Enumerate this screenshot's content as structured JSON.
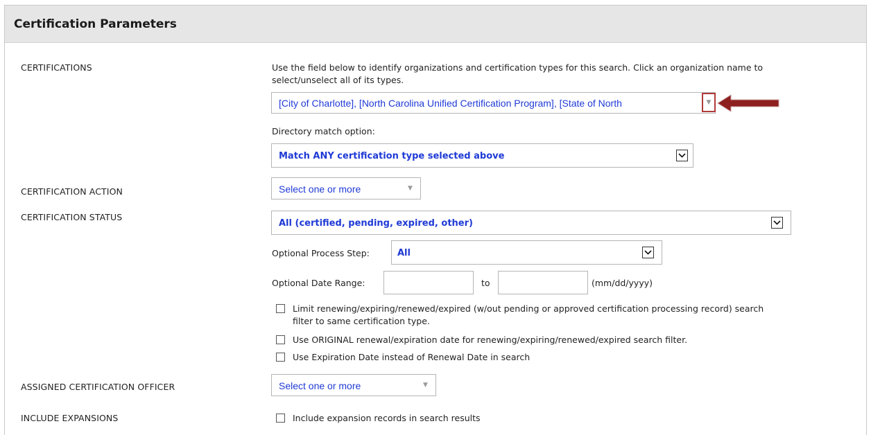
{
  "panel": {
    "title": "Certification Parameters"
  },
  "certifications": {
    "label": "CERTIFICATIONS",
    "help_line1": "Use the field below to identify organizations and certification types for this search. Click an organization name to",
    "help_line2": "select/unselect all of its types.",
    "selected_value": "[City of Charlotte], [North Carolina Unified Certification Program], [State of North",
    "dropdown_icon": "caret-down-icon",
    "match_label": "Directory match option:",
    "match_value": "Match ANY certification type selected above"
  },
  "certification_action": {
    "label": "CERTIFICATION ACTION",
    "placeholder": "Select one or more"
  },
  "certification_status": {
    "label": "CERTIFICATION STATUS",
    "value": "All (certified, pending, expired, other)",
    "process_step_label": "Optional Process Step:",
    "process_step_value": "All",
    "date_range_label": "Optional Date Range:",
    "date_from": "",
    "to_label": "to",
    "date_to": "",
    "date_format": "(mm/dd/yyyy)",
    "options": [
      {
        "line1": "Limit renewing/expiring/renewed/expired (w/out pending or approved certification processing record) search",
        "line2": "filter to same certification type.",
        "checked": false
      },
      {
        "line1": "Use ORIGINAL renewal/expiration date for renewing/expiring/renewed/expired search filter.",
        "checked": false
      },
      {
        "line1": "Use Expiration Date instead of Renewal Date in search",
        "checked": false
      }
    ]
  },
  "assigned_officer": {
    "label": "ASSIGNED CERTIFICATION OFFICER",
    "placeholder": "Select one or more"
  },
  "include_expansions": {
    "label": "INCLUDE EXPANSIONS",
    "option": "Include expansion records in search results",
    "checked": false
  },
  "annotation": {
    "highlight_color": "#b03a3a",
    "arrow_color": "#8e1f1f"
  }
}
